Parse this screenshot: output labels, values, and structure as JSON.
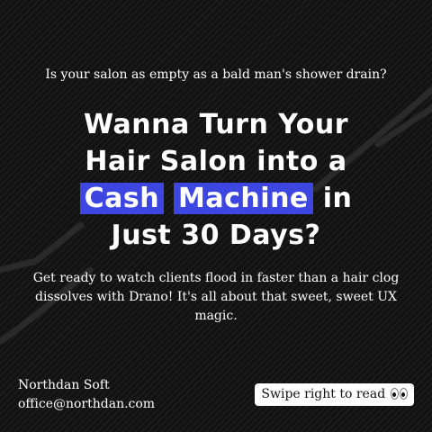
{
  "colors": {
    "background": "#121212",
    "highlight": "#3d46e0",
    "text": "#ffffff",
    "button_bg": "#ffffff",
    "button_text": "#111111"
  },
  "kicker": "Is your salon as empty as a bald man's shower drain?",
  "headline": {
    "line1": "Wanna Turn Your",
    "line2": "Hair Salon into a",
    "highlight1": "Cash",
    "highlight2": "Machine",
    "after_highlight": "in",
    "line4": "Just 30 Days?"
  },
  "body": "Get ready to watch clients flood in faster than a hair clog dissolves with Drano! It's all about that sweet, sweet UX magic.",
  "brand": {
    "name": "Northdan Soft",
    "email": "office@northdan.com"
  },
  "swipe_button": {
    "label": "Swipe right to read",
    "icon": "eyes-emoji-icon"
  }
}
